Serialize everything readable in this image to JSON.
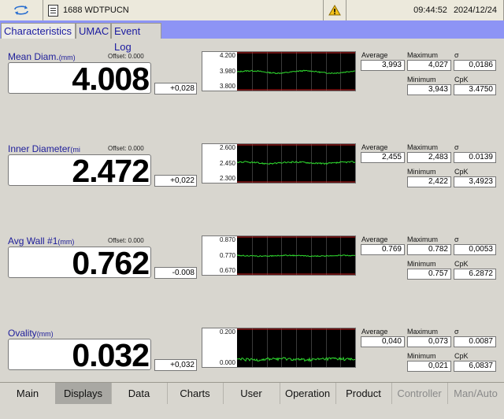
{
  "topbar": {
    "refresh_icon": "refresh-icon",
    "product_icon": "document-icon",
    "product_name": "1688 WDTPUCN",
    "warning_icon": "warning-icon",
    "time": "09:44:52",
    "date": "2024/12/24"
  },
  "tabs": [
    {
      "label": "Characteristics",
      "active": true
    },
    {
      "label": "UMAC",
      "active": false
    },
    {
      "label": "Event Log",
      "active": false
    }
  ],
  "stat_labels": {
    "average": "Average",
    "maximum": "Maximum",
    "sigma": "σ",
    "minimum": "Minimum",
    "cpk": "CpK"
  },
  "panels": [
    {
      "title": "Mean Diam.",
      "unit": "(mm)",
      "offset": "Offset: 0.000",
      "value": "4.008",
      "deviation": "+0,028",
      "ymax": "4.200",
      "ymid": "3.980",
      "ymin": "3.800",
      "average": "3,993",
      "maximum": "4,027",
      "sigma": "0,0186",
      "minimum": "3,943",
      "cpk": "3.4750",
      "trace": {
        "ymin": 3.8,
        "ymax": 4.2,
        "tol_lines": [
          4.2,
          3.8
        ],
        "nominal": 3.98,
        "level": 3.993,
        "noise": 0.006,
        "wave": 0.012
      }
    },
    {
      "title": "Inner Diameter",
      "unit": "(mi",
      "offset": "Offset: 0.000",
      "value": "2.472",
      "deviation": "+0,022",
      "ymax": "2.600",
      "ymid": "2.450",
      "ymin": "2.300",
      "average": "2,455",
      "maximum": "2,483",
      "sigma": "0.0139",
      "minimum": "2,422",
      "cpk": "3,4923",
      "trace": {
        "ymin": 2.3,
        "ymax": 2.6,
        "tol_lines": [
          2.6,
          2.3
        ],
        "nominal": 2.45,
        "level": 2.455,
        "noise": 0.006,
        "wave": 0.006
      }
    },
    {
      "title": "Avg Wall #1",
      "unit": "(mm)",
      "offset": "Offset: 0.000",
      "value": "0.762",
      "deviation": "-0.008",
      "ymax": "0.870",
      "ymid": "0.770",
      "ymin": "0.670",
      "average": "0.769",
      "maximum": "0.782",
      "sigma": "0,0053",
      "minimum": "0.757",
      "cpk": "6.2872",
      "trace": {
        "ymin": 0.67,
        "ymax": 0.87,
        "tol_lines": [
          0.87,
          0.67
        ],
        "nominal": 0.77,
        "level": 0.769,
        "noise": 0.0025,
        "wave": 0.002
      }
    },
    {
      "title": "Ovality",
      "unit": "(mm)",
      "offset": "",
      "value": "0.032",
      "deviation": "+0,032",
      "ymax": "0.200",
      "ymid": "",
      "ymin": "0.000",
      "average": "0,040",
      "maximum": "0,073",
      "sigma": "0.0087",
      "minimum": "0,021",
      "cpk": "6,0837",
      "trace": {
        "ymin": 0.0,
        "ymax": 0.2,
        "tol_lines": [
          0.2
        ],
        "nominal": null,
        "level": 0.04,
        "noise": 0.008,
        "wave": 0.003
      }
    }
  ],
  "bottom_tabs": [
    {
      "label": "Main",
      "state": "normal"
    },
    {
      "label": "Displays",
      "state": "active"
    },
    {
      "label": "Data",
      "state": "normal"
    },
    {
      "label": "Charts",
      "state": "normal"
    },
    {
      "label": "User",
      "state": "normal"
    },
    {
      "label": "Operation",
      "state": "normal"
    },
    {
      "label": "Product",
      "state": "normal"
    },
    {
      "label": "Controller",
      "state": "disabled"
    },
    {
      "label": "Man/Auto",
      "state": "disabled"
    }
  ],
  "colors": {
    "tabstrip": "#8d94f5",
    "trace": "#2fdc2f",
    "limit_line": "#c81e1e",
    "title": "#1d1d9a"
  }
}
